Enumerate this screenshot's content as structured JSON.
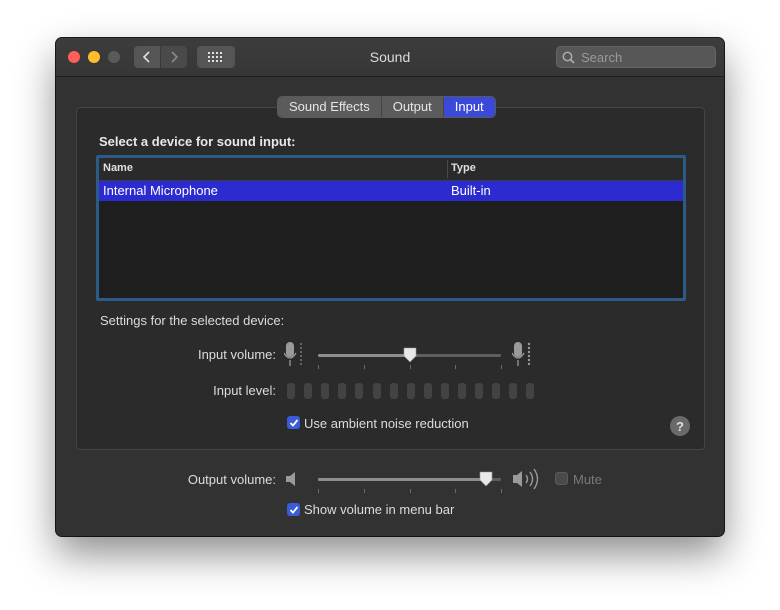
{
  "window": {
    "title": "Sound"
  },
  "search": {
    "placeholder": "Search"
  },
  "tabs": [
    {
      "label": "Sound Effects",
      "active": false
    },
    {
      "label": "Output",
      "active": false
    },
    {
      "label": "Input",
      "active": true
    }
  ],
  "input": {
    "section_title": "Select a device for sound input:",
    "table": {
      "columns": [
        "Name",
        "Type"
      ],
      "rows": [
        {
          "name": "Internal Microphone",
          "type": "Built-in",
          "selected": true
        }
      ]
    },
    "settings_label": "Settings for the selected device:",
    "input_volume_label": "Input volume:",
    "input_volume_fraction": 0.5,
    "input_level_label": "Input level:",
    "input_level_bar_count": 15,
    "ambient_noise": {
      "label": "Use ambient noise reduction",
      "checked": true
    },
    "help": "?"
  },
  "output": {
    "volume_label": "Output volume:",
    "volume_fraction": 0.92,
    "mute": {
      "label": "Mute",
      "checked": false
    },
    "show_in_menu_bar": {
      "label": "Show volume in menu bar",
      "checked": true
    }
  },
  "colors": {
    "accent": "#3b49d8",
    "selection": "#2b2bd1",
    "close": "#ff5f57",
    "minimize": "#febc2e"
  }
}
